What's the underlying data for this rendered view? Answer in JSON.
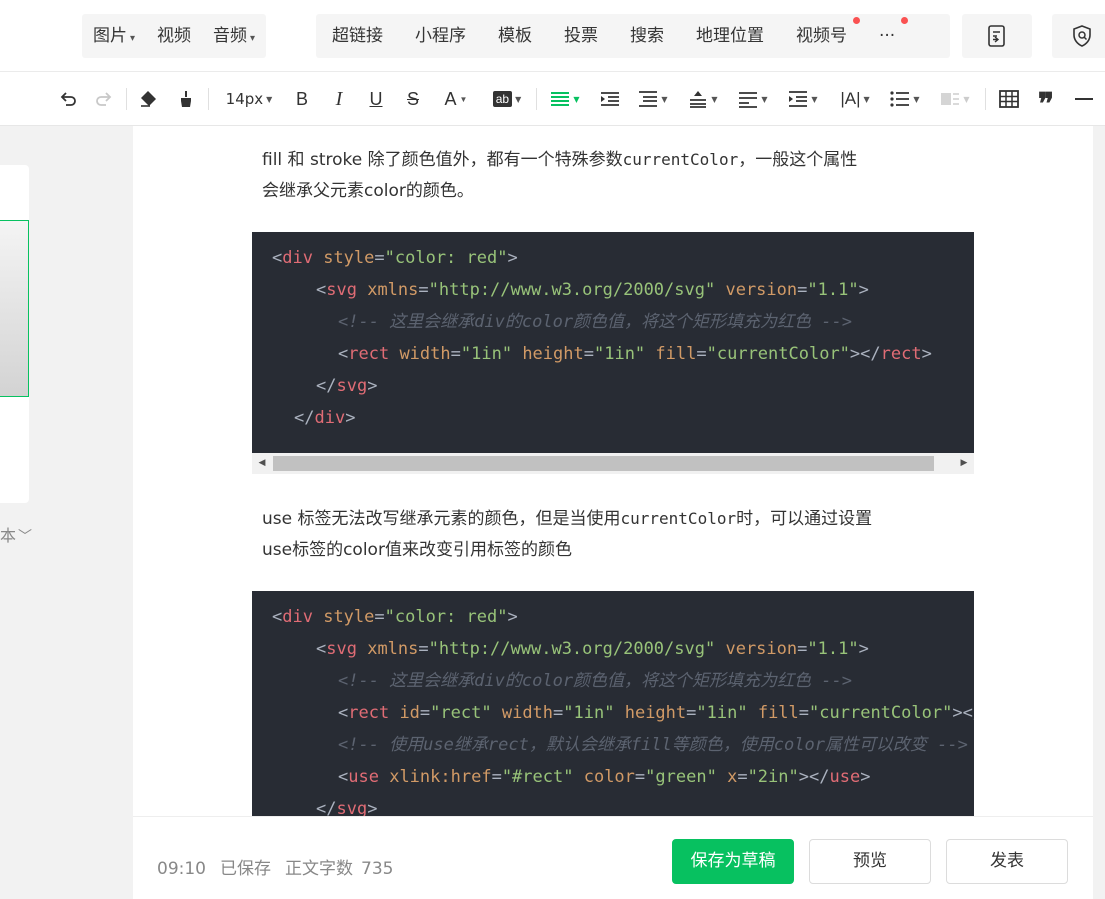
{
  "top_menu": {
    "group1": [
      "图片",
      "视频",
      "音频"
    ],
    "group2": [
      "超链接",
      "小程序",
      "模板",
      "投票",
      "搜索",
      "地理位置",
      "视频号",
      "···"
    ]
  },
  "toolbar": {
    "font_size": "14px"
  },
  "left_panel": {
    "label": "本"
  },
  "content": {
    "para1_a": "fill 和 stroke 除了颜色值外，都有一个特殊参数",
    "para1_mono": "currentColor",
    "para1_b": "，一般这个属性",
    "para1_line2": "会继承父元素color的颜色。",
    "para2_a": "use 标签无法改写继承元素的颜色，但是当使用",
    "para2_mono": "currentColor",
    "para2_b": "时，可以通过设置",
    "para2_line2": "use标签的color值来改变引用标签的颜色"
  },
  "code1": [
    [
      "<div ",
      "style",
      "=",
      "\"color: red\"",
      ">"
    ],
    [
      "<svg ",
      "xmlns",
      "=",
      "\"http://www.w3.org/2000/svg\"",
      " ",
      "version",
      "=",
      "\"1.1\"",
      ">"
    ],
    [
      "<!-- 这里会继承div的color颜色值，将这个矩形填充为红色 -->"
    ],
    [
      "<rect ",
      "width",
      "=",
      "\"1in\"",
      " ",
      "height",
      "=",
      "\"1in\"",
      " ",
      "fill",
      "=",
      "\"currentColor\"",
      "></rect>"
    ],
    [
      "</svg>"
    ],
    [
      "</div>"
    ]
  ],
  "code2": [
    [
      "<div ",
      "style",
      "=",
      "\"color: red\"",
      ">"
    ],
    [
      "<svg ",
      "xmlns",
      "=",
      "\"http://www.w3.org/2000/svg\"",
      " ",
      "version",
      "=",
      "\"1.1\"",
      ">"
    ],
    [
      "<!-- 这里会继承div的color颜色值，将这个矩形填充为红色 -->"
    ],
    [
      "<rect ",
      "id",
      "=",
      "\"rect\"",
      " ",
      "width",
      "=",
      "\"1in\"",
      " ",
      "height",
      "=",
      "\"1in\"",
      " ",
      "fill",
      "=",
      "\"currentColor\"",
      "></rect>"
    ],
    [
      "<!-- 使用use继承rect，默认会继承fill等颜色，使用color属性可以改变 -->"
    ],
    [
      "<use ",
      "xlink:href",
      "=",
      "\"#rect\"",
      " ",
      "color",
      "=",
      "\"green\"",
      " ",
      "x",
      "=",
      "\"2in\"",
      "></use>"
    ],
    [
      "</svg>"
    ]
  ],
  "footer": {
    "time": "09:10",
    "saved": "已保存",
    "word_count_label": "正文字数",
    "word_count": "735",
    "save_draft": "保存为草稿",
    "preview": "预览",
    "publish": "发表"
  },
  "colors": {
    "accent": "#07c160",
    "code_bg": "#282c34",
    "badge": "#fa5151"
  }
}
